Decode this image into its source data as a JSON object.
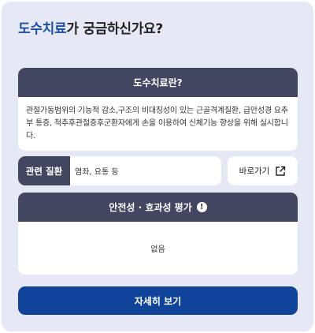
{
  "header": {
    "title_highlight": "도수치료",
    "title_rest": "가 궁금하신가요?"
  },
  "definition": {
    "heading": "도수치료란?",
    "body": "관절가동범위의 기능적 감소,구조의 비대칭성이 있는 근골격계질환, 급만성경 요추부 통증, 척추후관절증후군환자에게 손을 이용하여 신체기능 향상을 위해 실시합니다."
  },
  "related_disease": {
    "label": "관련 질환",
    "value": "염좌, 요통 등"
  },
  "go_button": {
    "label": "바로가기",
    "icon": "external-link-icon"
  },
  "evaluation": {
    "heading": "안전성 · 효과성 평가",
    "info_icon_glyph": "!",
    "body": "없음"
  },
  "detail_button": {
    "label": "자세히 보기"
  },
  "colors": {
    "panel_bg": "#e6e9f5",
    "header_bar": "#434660",
    "accent_blue": "#1b4fa0",
    "button_blue": "#10449a"
  }
}
